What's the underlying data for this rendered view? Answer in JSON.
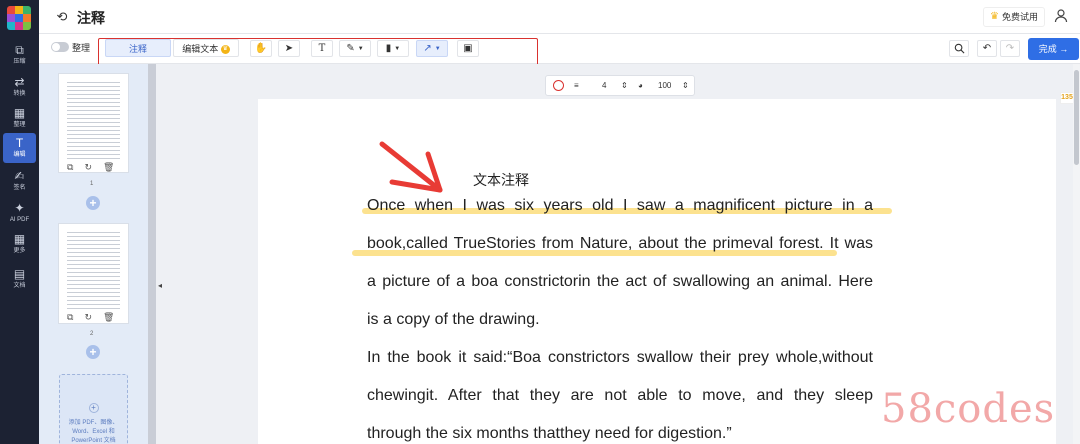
{
  "app": {
    "title": "注释",
    "trial_label": "免费试用"
  },
  "rail": {
    "items": [
      {
        "label": "压缩",
        "icon": "compress-icon"
      },
      {
        "label": "转换",
        "icon": "convert-icon"
      },
      {
        "label": "整理",
        "icon": "organize-icon"
      },
      {
        "label": "编辑",
        "icon": "edit-text-icon",
        "active": true
      },
      {
        "label": "签名",
        "icon": "signature-icon"
      },
      {
        "label": "AI PDF",
        "icon": "ai-sparkle-icon"
      },
      {
        "label": "更多",
        "icon": "grid-more-icon"
      },
      {
        "label": "文档",
        "icon": "document-icon"
      }
    ]
  },
  "toolbar": {
    "organize_toggle_label": "整理",
    "tab_annotate": "注释",
    "tab_edit_text": "编辑文本",
    "tools": [
      "hand-tool",
      "select-arrow",
      "text-tool",
      "pen-tool",
      "highlight-tool",
      "line-tool",
      "image-tool"
    ],
    "done_label": "完成"
  },
  "float_toolbar": {
    "stroke_width": "4",
    "opacity": "100"
  },
  "thumbnails": {
    "pages": [
      "1",
      "2"
    ],
    "add_file_hint": "添加 PDF、图像、Word、Excel 和 PowerPoint 文档"
  },
  "document": {
    "annotation_text": "文本注释",
    "paragraphs": [
      "Once when I was six years old I saw a magnificent picture in a",
      "book,called TrueStories from Nature, about the primeval forest. It was",
      "a picture of a boa constrictorin the act of swallowing an animal. Here",
      "is a copy of the drawing.",
      "In the book it said:“Boa constrictors swallow their prey whole,without",
      "chewingit. After that they are not able to move, and they sleep",
      "through the six months thatthey need for digestion.”"
    ]
  },
  "badge": "135",
  "watermark": "58codes",
  "colors": {
    "accent": "#2f6ee5",
    "annotation_frame": "#d9322f",
    "highlight": "#fbd86a",
    "rail": "#1c2233"
  }
}
